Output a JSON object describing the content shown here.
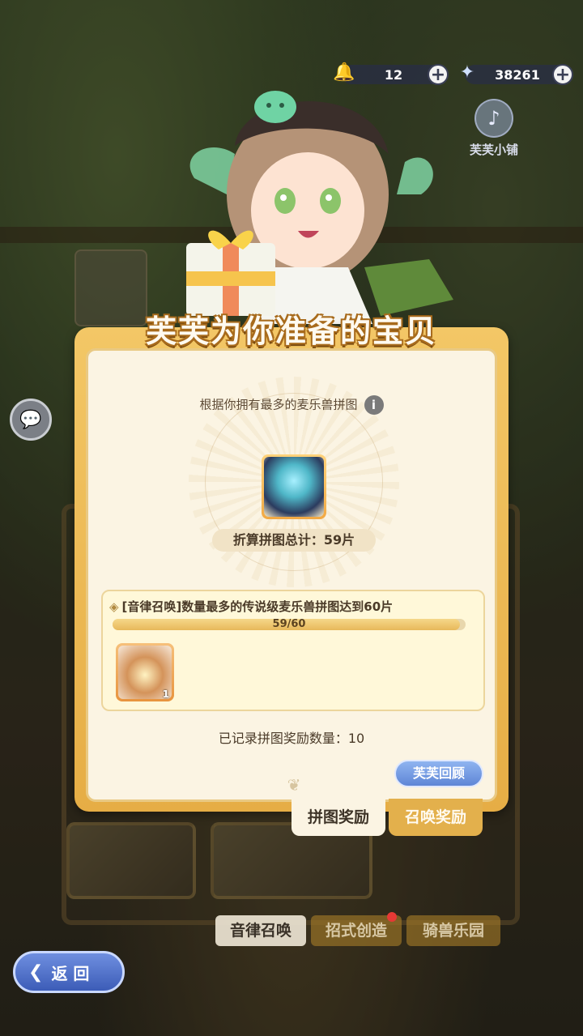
{
  "top_bar": {
    "bell_currency": "12",
    "star_currency": "38261",
    "shop_label": "芙芙小铺"
  },
  "panel": {
    "title": "芙芙为你准备的宝贝",
    "subtitle": "根据你拥有最多的麦乐兽拼图",
    "total_label": "折算拼图总计：59片",
    "task": {
      "description": "[音律召唤]数量最多的传说级麦乐兽拼图达到60片",
      "progress_text": "59/60",
      "progress_fraction": 0.983,
      "reward_count": "1"
    },
    "recorded_label": "已记录拼图奖励数量：10",
    "review_button": "芙芙回顾"
  },
  "tabs": [
    {
      "label": "拼图奖励",
      "active": true
    },
    {
      "label": "召唤奖励",
      "active": false
    }
  ],
  "bottom_tabs": [
    {
      "label": "音律召唤",
      "active": true
    },
    {
      "label": "招式创造",
      "active": false,
      "badge": true
    },
    {
      "label": "骑兽乐园",
      "active": false
    }
  ],
  "back_button": "返 回",
  "colors": {
    "panel_gold": "#f3c766",
    "panel_cream": "#fbf4e3",
    "review_blue": "#5f86d6",
    "back_blue": "#3c5cb7"
  }
}
